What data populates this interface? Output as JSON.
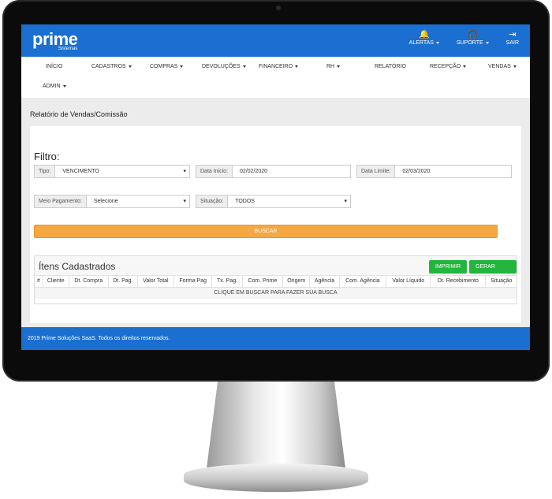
{
  "brand": {
    "name": "prime",
    "sub": "Sistemas"
  },
  "top_actions": [
    {
      "icon": "bell-icon",
      "glyph": "🔔",
      "label": "ALERTAS"
    },
    {
      "icon": "headset-icon",
      "glyph": "🎧",
      "label": "SUPORTE"
    },
    {
      "icon": "logout-icon",
      "glyph": "⇥",
      "label": "SAIR"
    }
  ],
  "nav": {
    "inicio": "INÍCIO",
    "cadastros": "CADASTROS",
    "compras": "COMPRAS",
    "devolucoes": "DEVOLUÇÕES",
    "financeiro": "FINANCEIRO",
    "rh": "RH",
    "relatorio": "RELATÓRIO",
    "recepcao": "RECEPÇÃO",
    "vendas": "VENDAS",
    "admin": "ADMIN"
  },
  "page_title": "Relatório de Vendas/Comissão",
  "filter": {
    "heading": "Filtro:",
    "tipo": {
      "label": "Tipo:",
      "value": "VENCIMENTO"
    },
    "data_inicio": {
      "label": "Data Inicio:",
      "value": "02/02/2020"
    },
    "data_limite": {
      "label": "Data Limite:",
      "value": "02/03/2020"
    },
    "meio_pagamento": {
      "label": "Meio Pagamento:",
      "value": "Selecione"
    },
    "situacao": {
      "label": "Situação:",
      "value": "TODOS"
    },
    "buscar": "BUSCAR"
  },
  "grid": {
    "title": "Ítens Cadastrados",
    "imprimir": "IMPRIMIR",
    "excel": "GERAR EXCEL",
    "columns": [
      "#",
      "Cliente",
      "Dt. Compra",
      "Dt. Pag.",
      "Valor Total",
      "Forma Pag",
      "Tx. Pag.",
      "Com. Prime",
      "Origem",
      "Agência",
      "Com. Agência",
      "Valor Líquido",
      "Dt. Recebimento",
      "Situação"
    ],
    "empty": "CLIQUE EM BUSCAR PARA FAZER SUA BUSCA"
  },
  "footer": "2019 Prime Soluções SaaS. Todos os direitos reservados.",
  "colors": {
    "primary": "#1a6fd0",
    "buscar": "#f5a742",
    "green": "#23b53e"
  }
}
